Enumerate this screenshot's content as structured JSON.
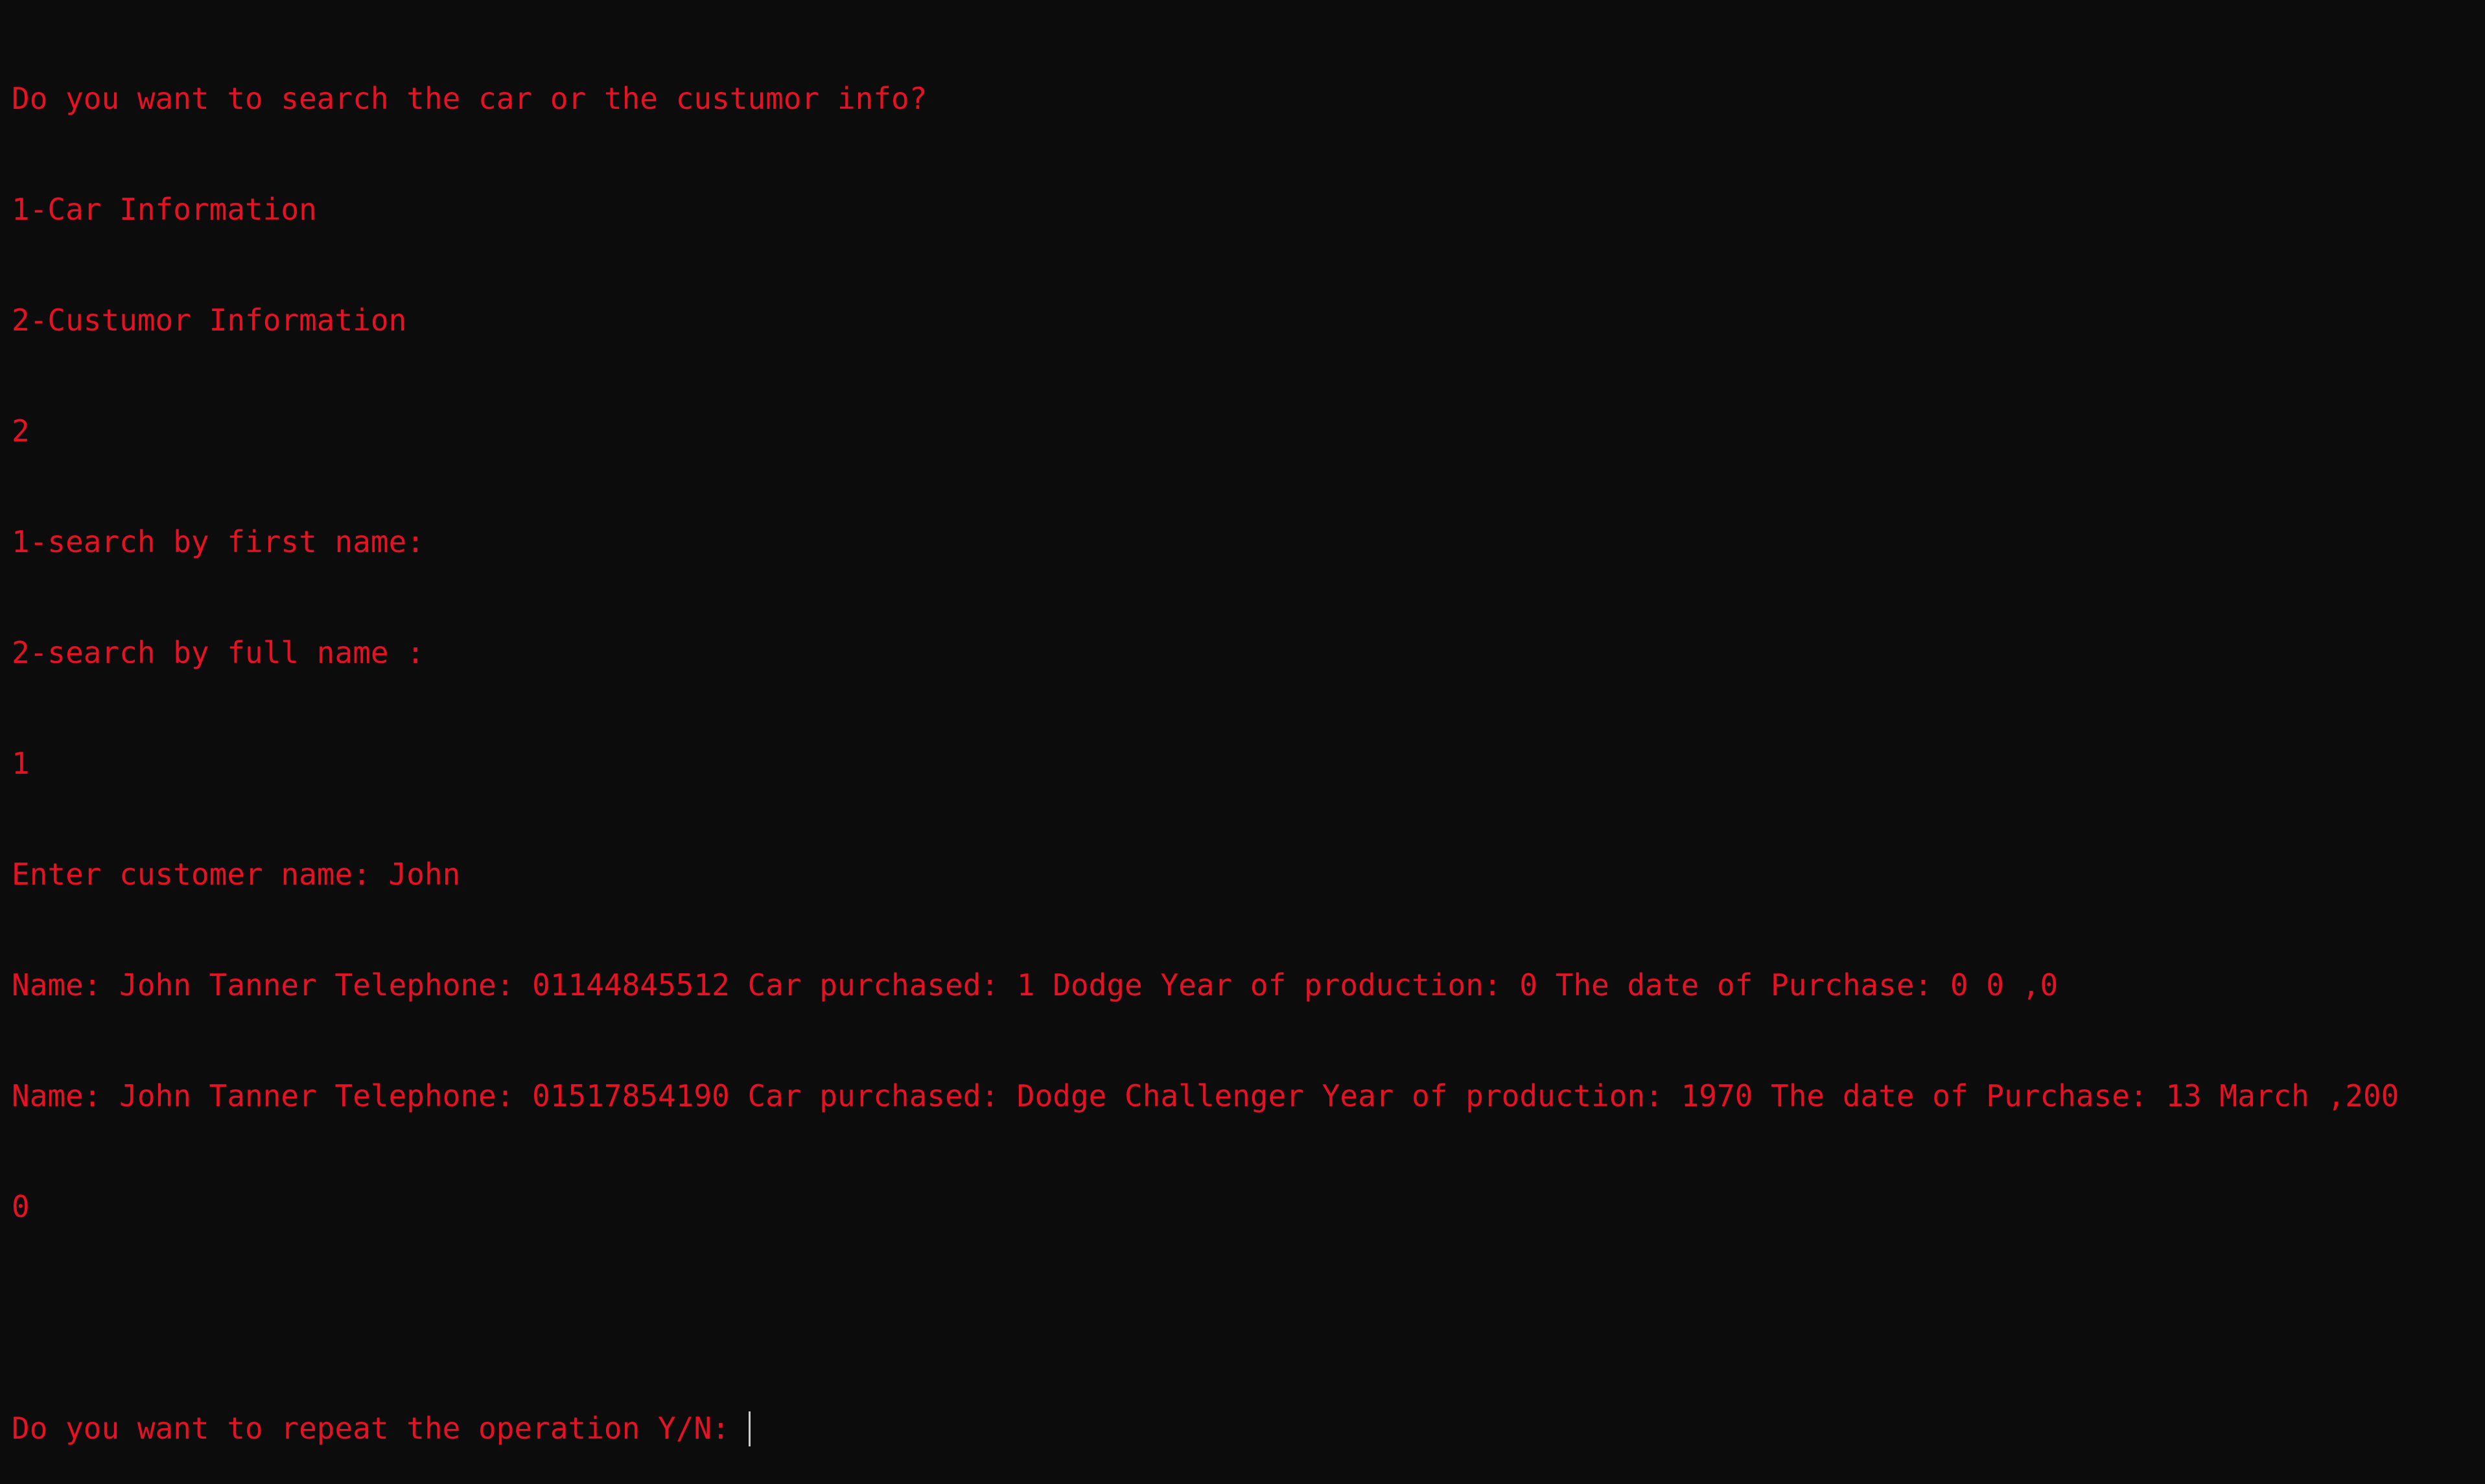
{
  "terminal": {
    "lines": [
      "Do you want to search the car or the custumor info?",
      "1-Car Information",
      "2-Custumor Information",
      "2",
      "1-search by first name:",
      "2-search by full name :",
      "1",
      "Enter customer name: John",
      "Name: John Tanner Telephone: 01144845512 Car purchased: 1 Dodge Year of production: 0 The date of Purchase: 0 0 ,0",
      "Name: John Tanner Telephone: 01517854190 Car purchased: Dodge Challenger Year of production: 1970 The date of Purchase: 13 March ,200",
      "0",
      ""
    ],
    "prompt": "Do you want to repeat the operation Y/N: ",
    "text_color": "#e81123",
    "background_color": "#0c0c0c",
    "cursor_color": "#cccccc"
  }
}
